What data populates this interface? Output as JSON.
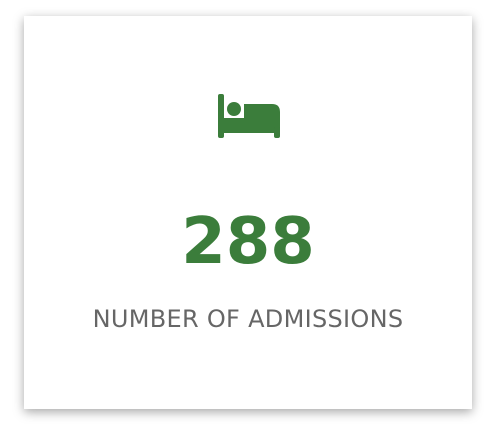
{
  "stat_card": {
    "icon": "bed-icon",
    "value": "288",
    "label": "NUMBER OF ADMISSIONS",
    "accent_color": "#3b7d3b",
    "label_color": "#666666"
  }
}
